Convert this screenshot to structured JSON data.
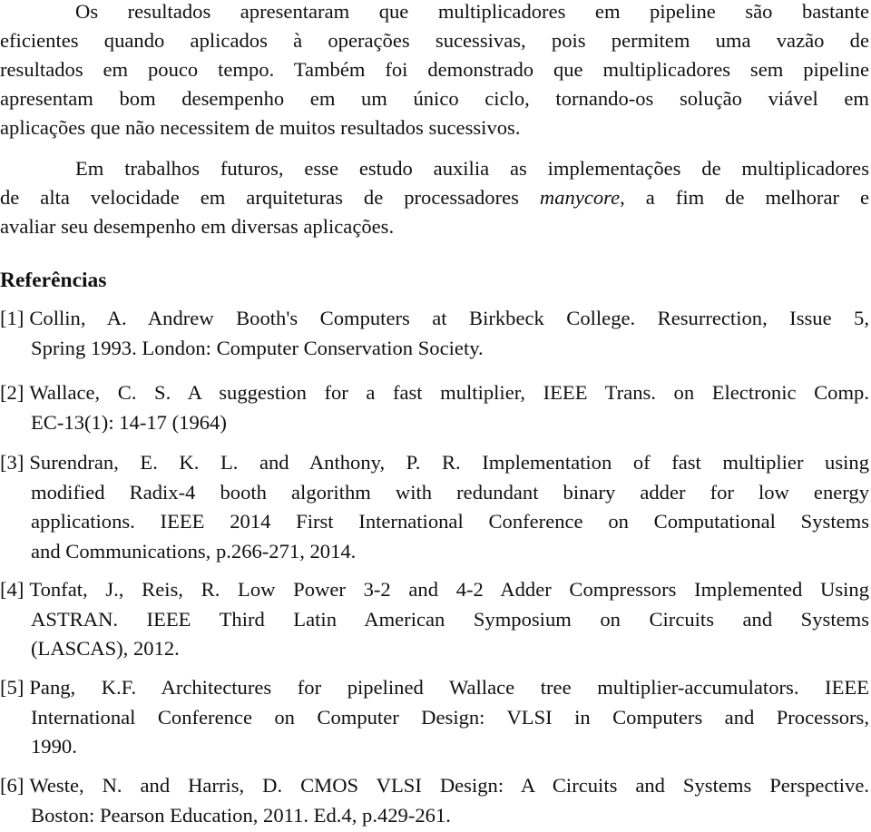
{
  "document": {
    "paragraph1": {
      "lines": [
        "Os resultados apresentaram que multiplicadores em pipeline são bastante",
        "eficientes quando aplicados à operações sucessivas, pois permitem uma vazão de",
        "resultados em pouco tempo. Também foi demonstrado que multiplicadores sem pipeline",
        "apresentam bom desempenho em um único ciclo, tornando-os solução viável em",
        "aplicações que não necessitem de muitos resultados sucessivos."
      ]
    },
    "paragraph2": {
      "line1": "Em trabalhos futuros, esse estudo auxilia as implementações de multiplicadores",
      "line2_before": "de alta velocidade em arquiteturas de processadores ",
      "line2_italic": "manycore",
      "line2_after": ", a fim de melhorar e",
      "line3": "avaliar seu desempenho em diversas aplicações."
    },
    "references_heading": "Referências",
    "references": [
      {
        "number": "[1]",
        "lines": [
          "Collin, A. Andrew Booth's Computers at Birkbeck College. Resurrection, Issue 5,",
          "Spring 1993. London: Computer Conservation Society."
        ]
      },
      {
        "number": "[2]",
        "lines": [
          "Wallace, C. S. A suggestion for a fast multiplier, IEEE Trans. on Electronic Comp.",
          "EC-13(1): 14-17 (1964)"
        ]
      },
      {
        "number": "[3]",
        "lines": [
          "Surendran, E. K. L. and Anthony, P. R. Implementation of fast multiplier using",
          "modified Radix-4 booth algorithm with redundant binary adder for low energy",
          "applications. IEEE 2014 First International Conference on Computational Systems",
          "and Communications, p.266-271, 2014."
        ]
      },
      {
        "number": "[4]",
        "lines": [
          "Tonfat, J., Reis, R. Low Power 3-2 and 4-2 Adder Compressors Implemented Using",
          "ASTRAN. IEEE Third Latin American Symposium on Circuits and Systems",
          "(LASCAS), 2012."
        ]
      },
      {
        "number": "[5]",
        "lines": [
          "Pang, K.F. Architectures for pipelined Wallace tree multiplier-accumulators. IEEE",
          "International Conference on Computer Design: VLSI in Computers and Processors,",
          "1990."
        ]
      },
      {
        "number": "[6]",
        "lines": [
          "Weste, N. and Harris, D. CMOS VLSI Design: A Circuits and Systems Perspective.",
          "Boston: Pearson Education, 2011. Ed.4, p.429-261."
        ]
      }
    ]
  }
}
